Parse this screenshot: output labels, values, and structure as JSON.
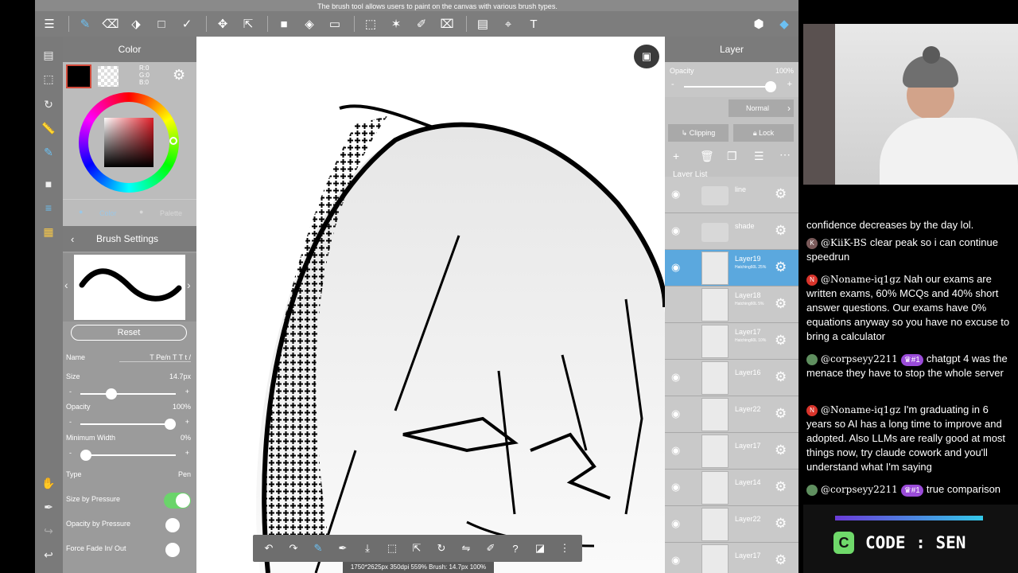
{
  "tooltip": "The brush tool allows users to paint on the canvas with various brush types.",
  "color_panel": {
    "title": "Color",
    "rgb": [
      "R:0",
      "G:0",
      "B:0"
    ],
    "tabs": [
      "Color",
      "Palette"
    ]
  },
  "brush_settings": {
    "title": "Brush Settings",
    "reset_label": "Reset",
    "name_label": "Name",
    "name_value": "T Pe/n T T t /",
    "size_label": "Size",
    "size_value": "14.7px",
    "size_level": 0.3,
    "opacity_label": "Opacity",
    "opacity_value": "100%",
    "opacity_level": 1.0,
    "min_width_label": "Minimum Width",
    "min_width_value": "0%",
    "min_width_level": 0.0,
    "type_label": "Type",
    "type_value": "Pen",
    "size_by_pressure_label": "Size by Pressure",
    "size_by_pressure_on": true,
    "opacity_by_pressure_label": "Opacity by Pressure",
    "opacity_by_pressure_on": false,
    "force_fade_label": "Force Fade In/ Out",
    "force_fade_on": false
  },
  "layer_panel": {
    "title": "Layer",
    "opacity_label": "Opacity",
    "opacity_value": "100%",
    "opacity_level": 1.0,
    "blend_mode": "Normal",
    "clipping_label": "Clipping",
    "lock_label": "Lock",
    "list_label": "Layer List",
    "layers": [
      {
        "name": "line",
        "sub": "",
        "folder": true,
        "visible": true,
        "selected": false
      },
      {
        "name": "shade",
        "sub": "",
        "folder": true,
        "visible": true,
        "selected": false
      },
      {
        "name": "Layer19",
        "sub": "Hatching60L 25%",
        "folder": false,
        "visible": true,
        "selected": true
      },
      {
        "name": "Layer18",
        "sub": "Hatching60L 5%",
        "folder": false,
        "visible": false,
        "selected": false
      },
      {
        "name": "Layer17",
        "sub": "Hatching60L 10%",
        "folder": false,
        "visible": false,
        "selected": false
      },
      {
        "name": "Layer16",
        "sub": "",
        "folder": false,
        "visible": true,
        "selected": false
      },
      {
        "name": "Layer22",
        "sub": "",
        "folder": false,
        "visible": true,
        "selected": false
      },
      {
        "name": "Layer17",
        "sub": "",
        "folder": false,
        "visible": true,
        "selected": false
      },
      {
        "name": "Layer14",
        "sub": "",
        "folder": false,
        "visible": true,
        "selected": false
      },
      {
        "name": "Layer22",
        "sub": "",
        "folder": false,
        "visible": true,
        "selected": false
      },
      {
        "name": "Layer17",
        "sub": "",
        "folder": false,
        "visible": true,
        "selected": false
      }
    ]
  },
  "status_bar": "1750*2625px 350dpi 559% Brush: 14.7px 100%",
  "chat": {
    "messages": [
      {
        "badge": "",
        "badge_color": "",
        "user": "",
        "rank": "",
        "text": "confidence decreases by the day lol."
      },
      {
        "badge": "K",
        "badge_color": "#7a5a5a",
        "user": "@KiiK-BS",
        "rank": "",
        "text": "clear peak so i can continue speedrun"
      },
      {
        "badge": "N",
        "badge_color": "#d9342b",
        "user": "@Noname-iq1gz",
        "rank": "",
        "text": "Nah our exams are written exams, 60% MCQs and 40% short answer questions. Our exams have 0% equations anyway so you have no excuse to bring a calculator"
      },
      {
        "badge": "",
        "badge_color": "#5f8f5f",
        "user": "@corpseyy2211",
        "rank": "#1",
        "text": "chatgpt 4 was the menace they have to stop the whole server"
      },
      {
        "badge": "N",
        "badge_color": "#d9342b",
        "user": "@Noname-iq1gz",
        "rank": "",
        "text": "I'm graduating in 6 years so AI has a long time to improve and adopted. Also LLMs are really good at most things now, try claude cowork and you'll understand what I'm saying"
      },
      {
        "badge": "",
        "badge_color": "#5f8f5f",
        "user": "@corpseyy2211",
        "rank": "#1",
        "text": "true comparison"
      }
    ]
  },
  "code_banner": {
    "text": "CODE : SEN",
    "letter": "C"
  }
}
